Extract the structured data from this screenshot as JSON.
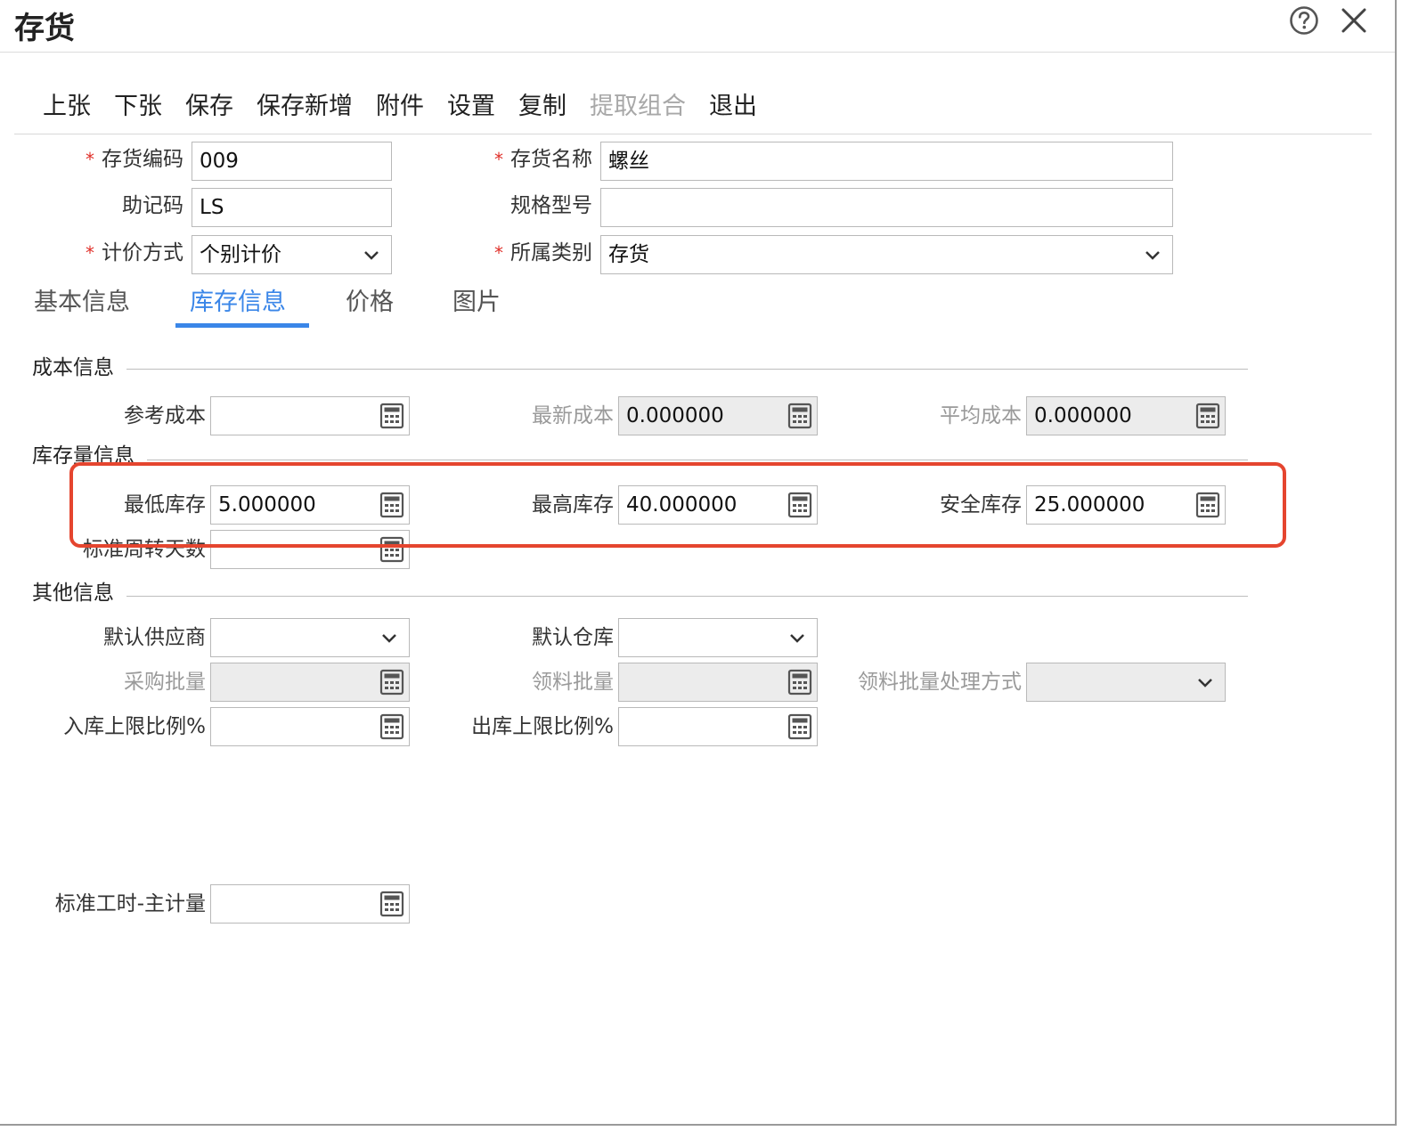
{
  "window": {
    "title": "存货",
    "help_icon": "question-circle-icon",
    "close_icon": "close-icon"
  },
  "toolbar": {
    "items": [
      "上张",
      "下张",
      "保存",
      "保存新增",
      "附件",
      "设置",
      "复制",
      "提取组合",
      "退出"
    ],
    "disabled_items": [
      "提取组合"
    ]
  },
  "header_form": {
    "code_label": "存货编码",
    "code_value": "009",
    "name_label": "存货名称",
    "name_value": "螺丝",
    "mnemonic_label": "助记码",
    "mnemonic_value": "LS",
    "spec_label": "规格型号",
    "spec_value": "",
    "pricing_label": "计价方式",
    "pricing_value": "个别计价",
    "category_label": "所属类别",
    "category_value": "存货",
    "required_mark": "*"
  },
  "tabs": {
    "items": [
      "基本信息",
      "库存信息",
      "价格",
      "图片"
    ],
    "active": "库存信息"
  },
  "cost_section": {
    "title": "成本信息",
    "ref_cost_label": "参考成本",
    "ref_cost_value": "",
    "latest_cost_label": "最新成本",
    "latest_cost_value": "0.000000",
    "avg_cost_label": "平均成本",
    "avg_cost_value": "0.000000"
  },
  "stock_section": {
    "title": "库存量信息",
    "min_label": "最低库存",
    "min_value": "5.000000",
    "max_label": "最高库存",
    "max_value": "40.000000",
    "safety_label": "安全库存",
    "safety_value": "25.000000",
    "turnover_label": "标准周转天数",
    "turnover_value": ""
  },
  "other_section": {
    "title": "其他信息",
    "supplier_label": "默认供应商",
    "supplier_value": "",
    "warehouse_label": "默认仓库",
    "warehouse_value": "",
    "purchase_batch_label": "采购批量",
    "purchase_batch_value": "",
    "pick_batch_label": "领料批量",
    "pick_batch_value": "",
    "pick_batch_method_label": "领料批量处理方式",
    "pick_batch_method_value": "",
    "inbound_limit_label": "入库上限比例%",
    "inbound_limit_value": "",
    "outbound_limit_label": "出库上限比例%",
    "outbound_limit_value": "",
    "std_hours_label": "标准工时-主计量",
    "std_hours_value": ""
  },
  "colors": {
    "accent": "#3a86e8",
    "required": "#e0302a",
    "highlight": "#e5452f"
  }
}
